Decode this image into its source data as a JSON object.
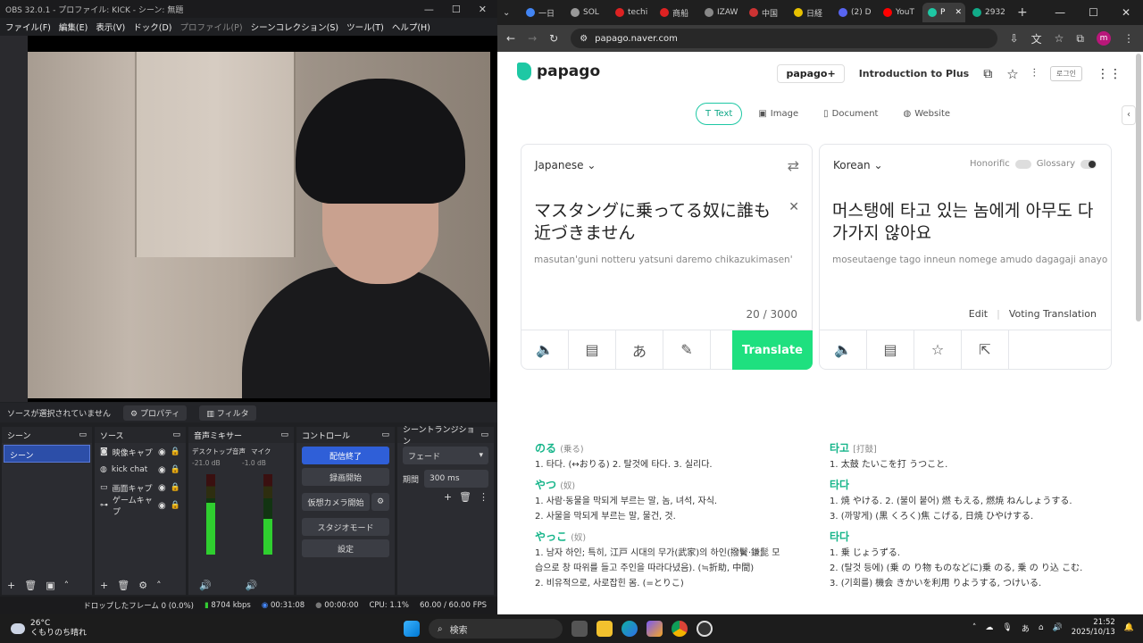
{
  "obs": {
    "title": "OBS 32.0.1 - プロファイル: KICK - シーン: 無題",
    "menu": [
      {
        "label": "ファイル(F)"
      },
      {
        "label": "編集(E)"
      },
      {
        "label": "表示(V)"
      },
      {
        "label": "ドック(D)"
      },
      {
        "label": "プロファイル(P)"
      },
      {
        "label": "シーンコレクション(S)"
      },
      {
        "label": "ツール(T)"
      },
      {
        "label": "ヘルプ(H)"
      }
    ],
    "no_source": "ソースが選択されていません",
    "properties": "プロパティ",
    "filters": "フィルタ",
    "docks": {
      "scenes": "シーン",
      "sources": "ソース",
      "mixer": "音声ミキサー",
      "controls": "コントロール",
      "transitions": "シーントランジション"
    },
    "scene_item": "シーン",
    "sources": [
      {
        "label": "映像キャプ"
      },
      {
        "label": "kick chat"
      },
      {
        "label": "画面キャプ"
      },
      {
        "label": "ゲームキャプ"
      }
    ],
    "mixer": {
      "desktop": "デスクトップ音声",
      "desktop_db": "-21.0 dB",
      "mic": "マイク",
      "mic_db": "-1.0 dB",
      "desktop_level": 0.65,
      "mic_level": 0.45
    },
    "controls": [
      {
        "label": "配信終了"
      },
      {
        "label": "録画開始"
      },
      {
        "label": "仮想カメラ開始"
      },
      {
        "label": "スタジオモード"
      },
      {
        "label": "設定"
      }
    ],
    "transition": {
      "type": "フェード",
      "duration_label": "期間",
      "duration": "300 ms"
    },
    "status": {
      "dropped": "ドロップしたフレーム 0 (0.0%)",
      "kbps": "8704 kbps",
      "stream_time": "00:31:08",
      "rec_time": "00:00:00",
      "cpu": "CPU: 1.1%",
      "fps": "60.00 / 60.00 FPS"
    }
  },
  "chrome": {
    "tabs": [
      {
        "label": "一日",
        "color": "#4285f4"
      },
      {
        "label": "SOL",
        "color": "#999999"
      },
      {
        "label": "techi",
        "color": "#d22"
      },
      {
        "label": "商船",
        "color": "#d22"
      },
      {
        "label": "IZAW",
        "color": "#888"
      },
      {
        "label": "中国",
        "color": "#c33"
      },
      {
        "label": "日経",
        "color": "#e8c100"
      },
      {
        "label": "(2) D",
        "color": "#5865f2"
      },
      {
        "label": "YouT",
        "color": "#f00"
      },
      {
        "label": "P",
        "color": "#1ec8a4"
      },
      {
        "label": "2932",
        "color": "#1a8"
      }
    ],
    "url": "papago.naver.com"
  },
  "papago": {
    "logo": "papago",
    "plus": "papago+",
    "intro": "Introduction to Plus",
    "login": "로그인",
    "modes": [
      {
        "label": "Text"
      },
      {
        "label": "Image"
      },
      {
        "label": "Document"
      },
      {
        "label": "Website"
      }
    ],
    "source": {
      "lang": "Japanese",
      "text": "マスタングに乗ってる奴に誰も近づきません",
      "roman": "masutan'guni notteru yatsuni daremo chikazukimasen'",
      "count": "20 / 3000"
    },
    "target": {
      "lang": "Korean",
      "text": "머스탱에 타고 있는 놈에게 아무도 다가가지 않아요",
      "roman": "moseutaenge tago inneun nomege amudo dagagaji anayo",
      "honorific": "Honorific",
      "glossary": "Glossary",
      "edit": "Edit",
      "voting": "Voting Translation"
    },
    "translate": "Translate",
    "dict_left": [
      {
        "word": "のる",
        "kanji": "(乗る)",
        "defs": [
          "1. 타다. (↔おりる)  2. 탈것에 타다.  3. 실리다."
        ]
      },
      {
        "word": "やつ",
        "kanji": "(奴)",
        "defs": [
          "1. 사람·동물을 막되게 부르는 말, 놈, 녀석, 자식.",
          "2. 사물을 막되게 부르는 말, 물건, 것."
        ]
      },
      {
        "word": "やっこ",
        "kanji": "(奴)",
        "defs": [
          "1. 남자 하인; 특히, 江戸 시대의 무가(武家)의 하인(撥鬢·鎌髭 모",
          "   습으로 창 따위를 들고 주인을 따라다녔음). (≒折助, 中間)",
          "2. 비유적으로, 사로잡힌 몸. (=とりこ)"
        ]
      }
    ],
    "dict_right": [
      {
        "word": "타고",
        "kanji": "[打鼓]",
        "defs": [
          "1. 太鼓 たいこを打 うつこと."
        ]
      },
      {
        "word": "타다",
        "kanji": "",
        "defs": [
          "1. 焼 やける.  2. (불이 붙어) 燃 もえる, 燃焼 ねんしょうする.",
          "3. (까맣게) (黒 くろく)焦 こげる, 日焼 ひやけする."
        ]
      },
      {
        "word": "타다",
        "kanji": "",
        "defs": [
          "1. 乗 じょうずる.",
          "2. (탈것 등에) (乗 の り物 ものなどに)乗 のる, 乗 の り込 こむ.",
          "3. (기회를) 機会 きかいを利用 りようする, つけいる."
        ]
      }
    ]
  },
  "taskbar": {
    "temp": "26°C",
    "weather": "くもりのち晴れ",
    "search": "検索",
    "time": "21:52",
    "date": "2025/10/13",
    "ime": "あ"
  }
}
